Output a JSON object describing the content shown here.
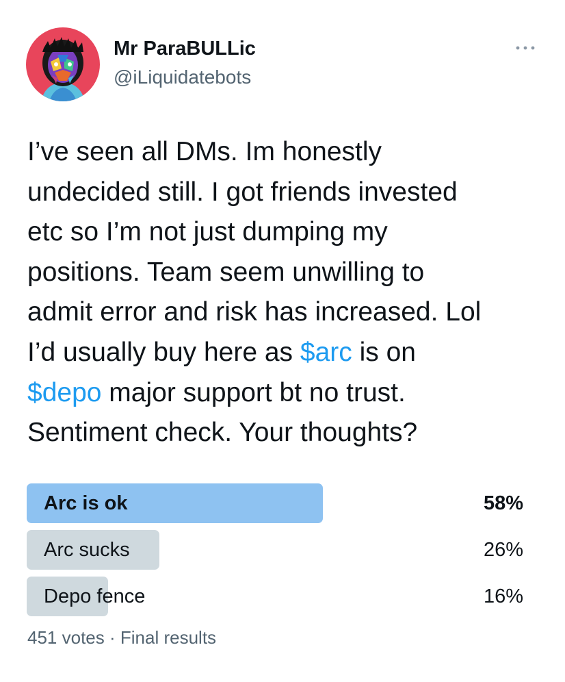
{
  "author": {
    "name": "Mr ParaBULLic",
    "handle": "@iLiquidatebots",
    "avatar_icon": "colorful-portrait-avatar",
    "avatar_bg": "#e8455b"
  },
  "menu": {
    "icon": "more-horizontal-icon"
  },
  "tweet": {
    "lines": [
      "I’ve seen all DMs. Im honestly",
      "undecided still. I got friends invested",
      "etc so I’m not just dumping my",
      "positions. Team seem unwilling to",
      "admit error and risk has increased. Lol",
      "I’d usually buy here as ",
      "$arc",
      " is on",
      "$depo",
      " major support bt no trust.",
      "Sentiment check. Your thoughts?"
    ],
    "cashtag_color": "#1d9bf0"
  },
  "poll": {
    "options": [
      {
        "label": "Arc is ok",
        "percent_text": "58%",
        "percent": 58,
        "winner": true
      },
      {
        "label": "Arc sucks",
        "percent_text": "26%",
        "percent": 26,
        "winner": false
      },
      {
        "label": "Depo fence",
        "percent_text": "16%",
        "percent": 16,
        "winner": false
      }
    ],
    "winner_color": "#8ec2f1",
    "bar_color": "#cfd9de",
    "votes_text": "451 votes",
    "separator": "·",
    "status_text": "Final results"
  }
}
